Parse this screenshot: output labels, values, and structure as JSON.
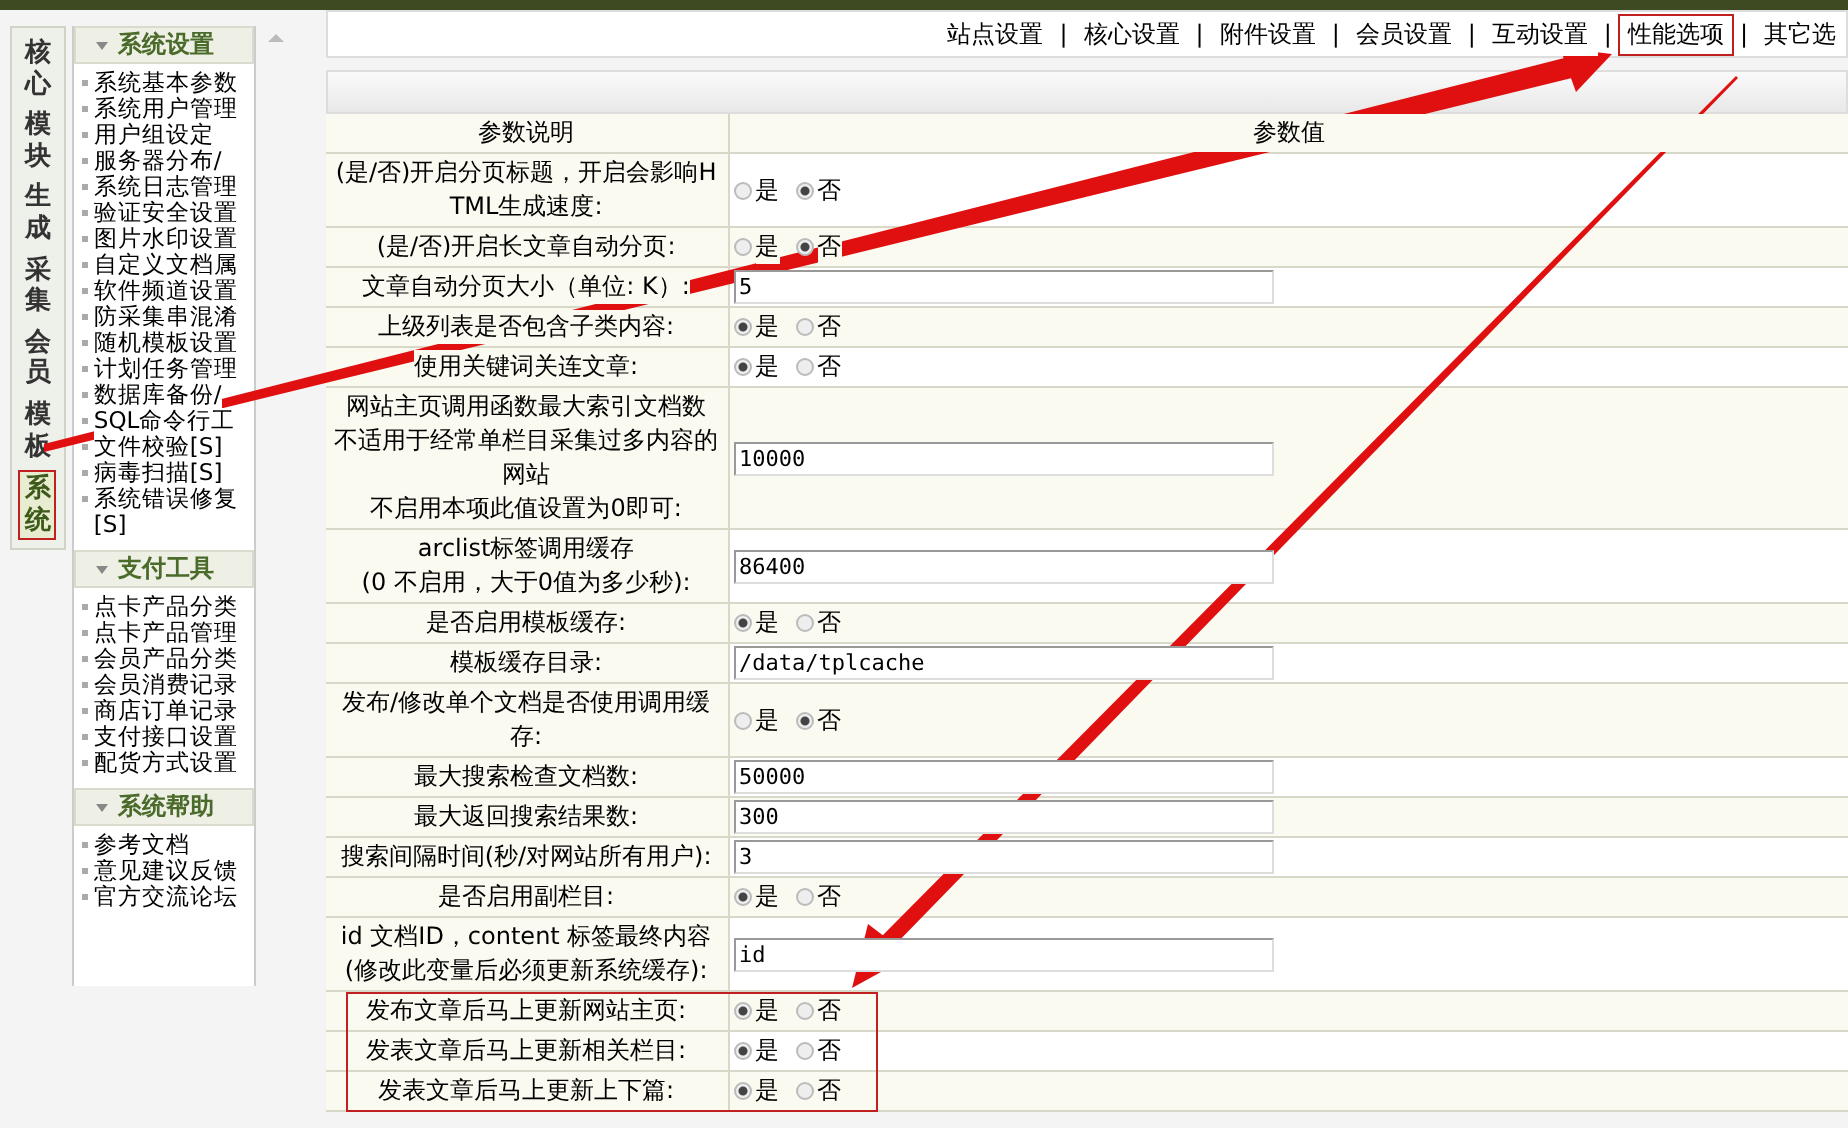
{
  "left_tabs": [
    {
      "label": "核心",
      "selected": false
    },
    {
      "label": "模块",
      "selected": false
    },
    {
      "label": "生成",
      "selected": false
    },
    {
      "label": "采集",
      "selected": false
    },
    {
      "label": "会员",
      "selected": false
    },
    {
      "label": "模板",
      "selected": false
    },
    {
      "label": "系统",
      "selected": true
    }
  ],
  "sidebar": {
    "sections": [
      {
        "title": "系统设置",
        "items": [
          "系统基本参数",
          "系统用户管理",
          "用户组设定",
          "服务器分布/",
          "系统日志管理",
          "验证安全设置",
          "图片水印设置",
          "自定义文档属",
          "软件频道设置",
          "防采集串混淆",
          "随机模板设置",
          "计划任务管理",
          "数据库备份/",
          "SQL命令行工",
          "文件校验[S]",
          "病毒扫描[S]",
          "系统错误修复[S]"
        ]
      },
      {
        "title": "支付工具",
        "items": [
          "点卡产品分类",
          "点卡产品管理",
          "会员产品分类",
          "会员消费记录",
          "商店订单记录",
          "支付接口设置",
          "配货方式设置"
        ]
      },
      {
        "title": "系统帮助",
        "items": [
          "参考文档",
          "意见建议反馈",
          "官方交流论坛"
        ]
      }
    ]
  },
  "top_nav": [
    {
      "kind": "link",
      "label": "站点设置",
      "highlighted": false
    },
    {
      "kind": "separator",
      "label": "|"
    },
    {
      "kind": "link",
      "label": "核心设置",
      "highlighted": false
    },
    {
      "kind": "separator",
      "label": "|"
    },
    {
      "kind": "link",
      "label": "附件设置",
      "highlighted": false
    },
    {
      "kind": "separator",
      "label": "|"
    },
    {
      "kind": "link",
      "label": "会员设置",
      "highlighted": false
    },
    {
      "kind": "separator",
      "label": "|"
    },
    {
      "kind": "link",
      "label": "互动设置",
      "highlighted": false
    },
    {
      "kind": "separator",
      "label": "|"
    },
    {
      "kind": "link",
      "label": "性能选项",
      "highlighted": true
    },
    {
      "kind": "separator",
      "label": "|"
    },
    {
      "kind": "link",
      "label": "其它选",
      "highlighted": false
    }
  ],
  "table": {
    "columns": [
      "参数说明",
      "参数值"
    ],
    "rows": [
      {
        "kind": "radio",
        "label": "(是/否)开启分页标题，开启会影响HTML生成速度:",
        "options": [
          {
            "label": "是",
            "selected": false
          },
          {
            "label": "否",
            "selected": true
          }
        ],
        "highlighted": false
      },
      {
        "kind": "radio",
        "label": "(是/否)开启长文章自动分页:",
        "options": [
          {
            "label": "是",
            "selected": false
          },
          {
            "label": "否",
            "selected": true
          }
        ],
        "highlighted": false
      },
      {
        "kind": "text",
        "label": "文章自动分页大小（单位: K）:",
        "value": "5",
        "highlighted": false
      },
      {
        "kind": "radio",
        "label": "上级列表是否包含子类内容:",
        "options": [
          {
            "label": "是",
            "selected": true
          },
          {
            "label": "否",
            "selected": false
          }
        ],
        "highlighted": false
      },
      {
        "kind": "radio",
        "label": "使用关键词关连文章:",
        "options": [
          {
            "label": "是",
            "selected": true
          },
          {
            "label": "否",
            "selected": false
          }
        ],
        "highlighted": false
      },
      {
        "kind": "text",
        "label": "网站主页调用函数最大索引文档数",
        "label_more": [
          "不适用于经常单栏目采集过多内容的网站",
          "不启用本项此值设置为0即可:"
        ],
        "value": "10000",
        "highlighted": false
      },
      {
        "kind": "text",
        "label": "arclist标签调用缓存\n(0 不启用，大于0值为多少秒):",
        "value": "86400",
        "highlighted": false
      },
      {
        "kind": "radio",
        "label": "是否启用模板缓存:",
        "options": [
          {
            "label": "是",
            "selected": true
          },
          {
            "label": "否",
            "selected": false
          }
        ],
        "highlighted": false
      },
      {
        "kind": "text",
        "label": "模板缓存目录:",
        "value": "/data/tplcache",
        "highlighted": false
      },
      {
        "kind": "radio",
        "label": "发布/修改单个文档是否使用调用缓存:",
        "options": [
          {
            "label": "是",
            "selected": false
          },
          {
            "label": "否",
            "selected": true
          }
        ],
        "highlighted": false
      },
      {
        "kind": "text",
        "label": "最大搜索检查文档数:",
        "value": "50000",
        "highlighted": false
      },
      {
        "kind": "text",
        "label": "最大返回搜索结果数:",
        "value": "300",
        "highlighted": false
      },
      {
        "kind": "text",
        "label": "搜索间隔时间(秒/对网站所有用户):",
        "value": "3",
        "highlighted": false
      },
      {
        "kind": "radio",
        "label": "是否启用副栏目:",
        "options": [
          {
            "label": "是",
            "selected": true
          },
          {
            "label": "否",
            "selected": false
          }
        ],
        "highlighted": false
      },
      {
        "kind": "text",
        "label": "id 文档ID，content 标签最终内容\n(修改此变量后必须更新系统缓存):",
        "value": "id",
        "highlighted": false
      },
      {
        "kind": "radio",
        "label": "发布文章后马上更新网站主页:",
        "options": [
          {
            "label": "是",
            "selected": true
          },
          {
            "label": "否",
            "selected": false
          }
        ],
        "highlighted": true
      },
      {
        "kind": "radio",
        "label": "发表文章后马上更新相关栏目:",
        "options": [
          {
            "label": "是",
            "selected": true
          },
          {
            "label": "否",
            "selected": false
          }
        ],
        "highlighted": true
      },
      {
        "kind": "radio",
        "label": "发表文章后马上更新上下篇:",
        "options": [
          {
            "label": "是",
            "selected": true
          },
          {
            "label": "否",
            "selected": false
          }
        ],
        "highlighted": true
      }
    ]
  }
}
